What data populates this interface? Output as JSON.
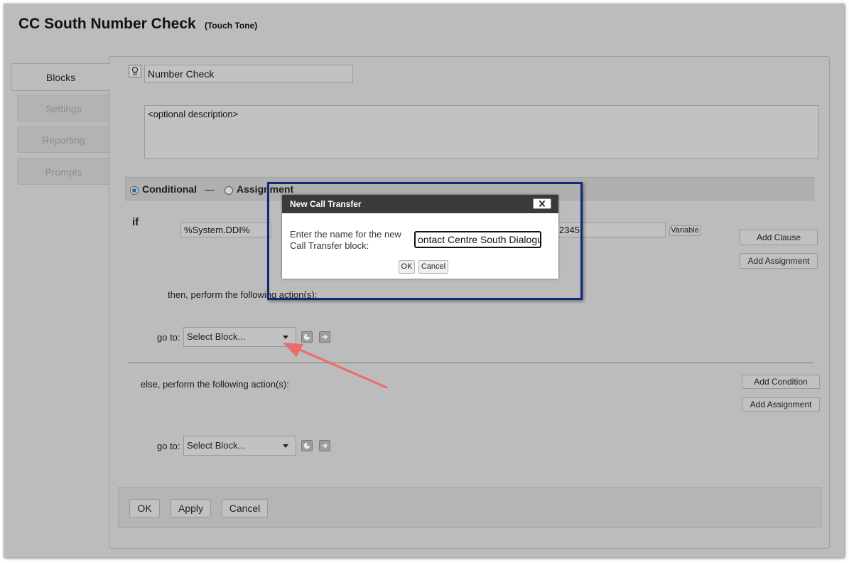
{
  "header": {
    "title": "CC South Number Check",
    "subtitle": "(Touch Tone)"
  },
  "side_tabs": [
    {
      "label": "Blocks",
      "active": true
    },
    {
      "label": "Settings",
      "active": false
    },
    {
      "label": "Reporting",
      "active": false
    },
    {
      "label": "Prompts",
      "active": false
    }
  ],
  "block": {
    "name": "Number Check",
    "description": "<optional description>"
  },
  "mode": {
    "conditional_label": "Conditional",
    "separator": "—",
    "assignment_label": "Assignment",
    "selected": "Conditional"
  },
  "if_section": {
    "if_label": "if",
    "variable_value": "%System.DDI%",
    "compare_value_partial": "2345",
    "variable_button": "Variable",
    "add_clause": "Add Clause",
    "add_assignment": "Add Assignment",
    "then_label": "then, perform the following action(s):",
    "goto_label": "go to:",
    "goto_select": "Select Block..."
  },
  "else_section": {
    "else_label": "else, perform the following action(s):",
    "add_condition": "Add Condition",
    "add_assignment": "Add Assignment",
    "goto_label": "go to:",
    "goto_select": "Select Block..."
  },
  "footer": {
    "ok": "OK",
    "apply": "Apply",
    "cancel": "Cancel"
  },
  "dialog": {
    "title": "New Call Transfer",
    "prompt_line1": "Enter the name for the new",
    "prompt_line2": "Call Transfer block:",
    "input_value": "ontact Centre South Dialogue",
    "ok": "OK",
    "cancel": "Cancel"
  },
  "annotation": {
    "highlight_color": "#0e2a78",
    "arrow_color": "#ef6a6a"
  },
  "icons": [
    "bulb-icon",
    "close-icon",
    "chevron-down-icon",
    "refresh-icon",
    "arrow-right-icon"
  ]
}
